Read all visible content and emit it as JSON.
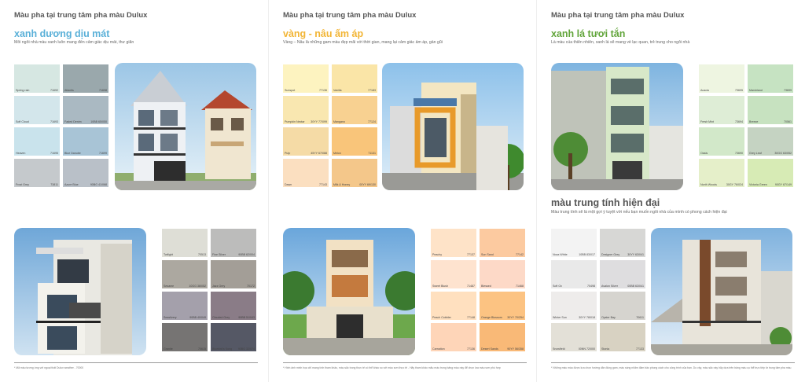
{
  "page1": {
    "heading": "Màu pha tại trung tâm pha màu Dulux",
    "title": "xanh dương dịu mát",
    "title_color": "#5ab0d8",
    "desc": "Mỗi ngôi nhà màu xanh luôn mang đến cảm giác dịu mát, thư giãn",
    "swatches_top": [
      {
        "name": "Spring rain",
        "code": "71692",
        "color": "#d6e7e2"
      },
      {
        "name": "Atlantis",
        "code": "71698",
        "color": "#9aa8ac"
      },
      {
        "name": "Soft Cloud",
        "code": "71693",
        "color": "#d3e6eb"
      },
      {
        "name": "Faded Denim",
        "code": "10BB 65/050",
        "color": "#aab9c2"
      },
      {
        "name": "Heaven",
        "code": "71695",
        "color": "#c9e3ec"
      },
      {
        "name": "Blue Danube",
        "code": "71699",
        "color": "#a8c4d6"
      },
      {
        "name": "Frost Grey",
        "code": "73811",
        "color": "#c5c9cc"
      },
      {
        "name": "Azure Blue",
        "code": "90BG 41/068",
        "color": "#b9c0c8"
      }
    ],
    "swatches_bottom": [
      {
        "name": "Twilight",
        "code": "70513",
        "color": "#deded6"
      },
      {
        "name": "Fine Silver",
        "code": "90BB 62/004",
        "color": "#bcbcbb"
      },
      {
        "name": "Sesame",
        "code": "10GG 38/052",
        "color": "#aca8a0"
      },
      {
        "name": "Jazz Grey",
        "code": "70172",
        "color": "#a39e97"
      },
      {
        "name": "Seasilvery",
        "code": "90BB 40/049",
        "color": "#a4a0ab"
      },
      {
        "name": "Clouded Grey",
        "code": "90BB 51/043",
        "color": "#8a7c87"
      },
      {
        "name": "Granite",
        "code": "70615",
        "color": "#767473"
      },
      {
        "name": "Bluebird's Song",
        "code": "90BG 32/074",
        "color": "#555865"
      }
    ],
    "footnote": "* Mã màu tương ứng với ngoại thất Dulux weather - 70000"
  },
  "page2": {
    "heading": "Màu pha tại trung tâm pha màu Dulux",
    "title": "vàng - nâu ấm áp",
    "title_color": "#f2b535",
    "desc": "Vàng – Nâu là những gam màu đẹp mãi với thời gian, mang lại cảm giác ấm áp, gần gũi",
    "swatches_top": [
      {
        "name": "Sunspot",
        "code": "77136",
        "color": "#fdf3c0"
      },
      {
        "name": "Vanilla",
        "code": "77183",
        "color": "#fae5a7"
      },
      {
        "name": "Pumpkin Nectar",
        "code": "30YY 77/099",
        "color": "#f9e7b0"
      },
      {
        "name": "Mangano",
        "code": "77124",
        "color": "#f8d191"
      },
      {
        "name": "Pulp",
        "code": "45YY 67/088",
        "color": "#f5dba6"
      },
      {
        "name": "Melon",
        "code": "71131",
        "color": "#f9c57a"
      },
      {
        "name": "Dawn",
        "code": "77143",
        "color": "#fbdfc0"
      },
      {
        "name": "Milk & Honey",
        "code": "00YY 69/130",
        "color": "#f4c78a"
      }
    ],
    "swatches_bottom": [
      {
        "name": "Peachy",
        "code": "77137",
        "color": "#fee3c8"
      },
      {
        "name": "Sun Sand",
        "code": "77142",
        "color": "#fccaa0"
      },
      {
        "name": "Sweet Blush",
        "code": "71487",
        "color": "#fee3cf"
      },
      {
        "name": "Blessed",
        "code": "71468",
        "color": "#fdd9c7"
      },
      {
        "name": "Peach Cobbler",
        "code": "77148",
        "color": "#ffe0bf"
      },
      {
        "name": "Orange Blossom",
        "code": "30YY 70/254",
        "color": "#fcc382"
      },
      {
        "name": "Carnation",
        "code": "77136",
        "color": "#fed5b8"
      },
      {
        "name": "Desert Sands",
        "code": "90YY 56/358",
        "color": "#f9b977"
      }
    ],
    "footnote": "* Hình ảnh minh họa chỉ mang tính tham khảo, màu sắc trong thực tế có thể khác so với màu sơn thực tế - Hãy tham khảo mẫu màu trong bảng màu này để chọn lựa màu sơn phù hợp"
  },
  "page3": {
    "heading": "Màu pha tại trung tâm pha màu Dulux",
    "title": "xanh lá tươi tắn",
    "title_color": "#62a53b",
    "desc": "Là màu của thiên nhiên, xanh lá sẽ mang về lạc quan, trẻ trung cho ngôi nhà",
    "swatches_top": [
      {
        "name": "Acacia",
        "code": "73695",
        "color": "#eef5e1"
      },
      {
        "name": "Marshland",
        "code": "73699",
        "color": "#c6e3c2"
      },
      {
        "name": "Fresh Mint",
        "code": "73694",
        "color": "#deedd6"
      },
      {
        "name": "Breeze",
        "code": "70561",
        "color": "#c7e2c0"
      },
      {
        "name": "Oasis",
        "code": "73690",
        "color": "#d2e8c9"
      },
      {
        "name": "Grey Leaf",
        "code": "30GG 63/052",
        "color": "#c5d3c2"
      },
      {
        "name": "North Woods",
        "code": "30GY 76/024",
        "color": "#e5efc9"
      },
      {
        "name": "Victoria Green",
        "code": "90GY 67/149",
        "color": "#d7ebb5"
      }
    ],
    "title2": "màu trung tính hiện đại",
    "desc2": "Màu trung tính sẽ là một gợi ý tuyệt vời nếu bạn muốn ngôi nhà của mình có phong cách hiện đại",
    "swatches_bottom": [
      {
        "name": "Nova White",
        "code": "10BB 83/017",
        "color": "#f3f3f3"
      },
      {
        "name": "Designer Grey",
        "code": "30YY 63/041",
        "color": "#d7d7d5"
      },
      {
        "name": "Soft Ox",
        "code": "70498",
        "color": "#e9e9e9"
      },
      {
        "name": "Avalon Silver",
        "code": "00BB 63/041",
        "color": "#dedddf"
      },
      {
        "name": "Winter Sun",
        "code": "30YY 78/018",
        "color": "#eeeceb"
      },
      {
        "name": "Oyster Bay",
        "code": "70611",
        "color": "#d6d4cf"
      },
      {
        "name": "Snowfield",
        "code": "00NN 72/000",
        "color": "#e3e0d7"
      },
      {
        "name": "Stonia",
        "code": "77133",
        "color": "#d8d2c2"
      }
    ],
    "footnote": "* Những màu màu được lựa chọn hướng dẫn đúng gam, màu sáng nhằm đảm bảo phong cách cho công trình của bạn. Do vậy, màu sắc này hãy dựa trên bảng màu cụ thể trực tiếp từ trung tâm pha màu"
  }
}
